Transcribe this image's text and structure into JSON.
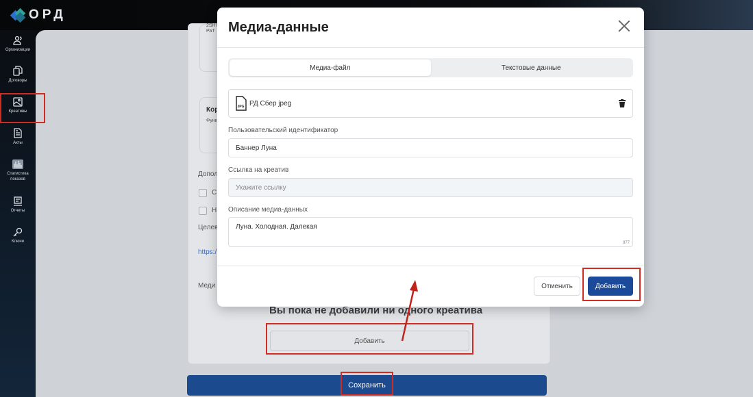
{
  "app": {
    "logo": "ОРД"
  },
  "sidebar": {
    "items": [
      {
        "label": "Организации",
        "icon": "users-icon"
      },
      {
        "label": "Договоры",
        "icon": "documents-icon"
      },
      {
        "label": "Креативы",
        "icon": "image-icon"
      },
      {
        "label": "Акты",
        "icon": "file-text-icon"
      },
      {
        "label": "Статистика показов",
        "icon": "stats-icon"
      },
      {
        "label": "Отчеты",
        "icon": "report-icon"
      },
      {
        "label": "Ключи",
        "icon": "key-icon"
      }
    ]
  },
  "background_form": {
    "card1_line1": "2SHI",
    "card1_line2": "РаТ",
    "card2_title": "Кор",
    "card2_sub": "Функ",
    "section_label": "Допол",
    "checkbox1": "С",
    "checkbox2": "Н",
    "target_label": "Целев",
    "link": "https:/",
    "media_label": "Меди",
    "empty_title": "Вы пока не добавили ни одного креатива",
    "add_label": "Добавить",
    "save_label": "Сохранить"
  },
  "modal": {
    "title": "Медиа-данные",
    "tabs": [
      {
        "label": "Медиа-файл",
        "active": true
      },
      {
        "label": "Текстовые данные",
        "active": false
      }
    ],
    "file": {
      "name": "РД Сбер jpeg",
      "type": "JPG"
    },
    "fields": {
      "user_id_label": "Пользовательский идентификатор",
      "user_id_value": "Баннер Луна",
      "link_label": "Ссылка на креатив",
      "link_placeholder": "Укажите ссылку",
      "description_label": "Описание медиа-данных",
      "description_value": "Луна. Холодная. Далекая",
      "description_counter": "977"
    },
    "cancel_label": "Отменить",
    "add_label": "Добавить"
  },
  "colors": {
    "primary": "#1c4a9a",
    "annotation": "#d22b22"
  }
}
